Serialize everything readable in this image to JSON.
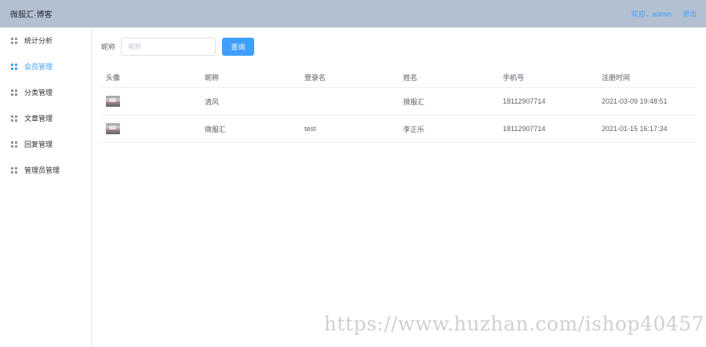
{
  "header": {
    "title": "微服汇·博客",
    "welcome": "欢迎，admin",
    "logout": "退出"
  },
  "sidebar": {
    "items": [
      {
        "label": "统计分析",
        "icon": "grid-icon",
        "active": false
      },
      {
        "label": "会员管理",
        "icon": "grid-icon",
        "active": true
      },
      {
        "label": "分类管理",
        "icon": "grid-icon",
        "active": false
      },
      {
        "label": "文章管理",
        "icon": "grid-icon",
        "active": false
      },
      {
        "label": "回复管理",
        "icon": "grid-icon",
        "active": false
      },
      {
        "label": "管理员管理",
        "icon": "grid-icon",
        "active": false
      }
    ]
  },
  "search": {
    "label": "昵称",
    "placeholder": "昵称",
    "value": "",
    "button": "查询"
  },
  "table": {
    "columns": [
      "头像",
      "昵称",
      "登录名",
      "姓名",
      "手机号",
      "注册时间"
    ],
    "rows": [
      {
        "avatar": "avatar-image",
        "nickname": "清风",
        "login": "",
        "name": "微服汇",
        "phone": "18112907714",
        "registered": "2021-03-09 19:48:51"
      },
      {
        "avatar": "avatar-image",
        "nickname": "微服汇",
        "login": "test",
        "name": "李正乐",
        "phone": "18112907714",
        "registered": "2021-01-15 16:17:34"
      }
    ]
  },
  "watermark": "https://www.huzhan.com/ishop40457",
  "colors": {
    "header_bg": "#b2c0d1",
    "accent": "#409eff",
    "border": "#ebeef5"
  }
}
